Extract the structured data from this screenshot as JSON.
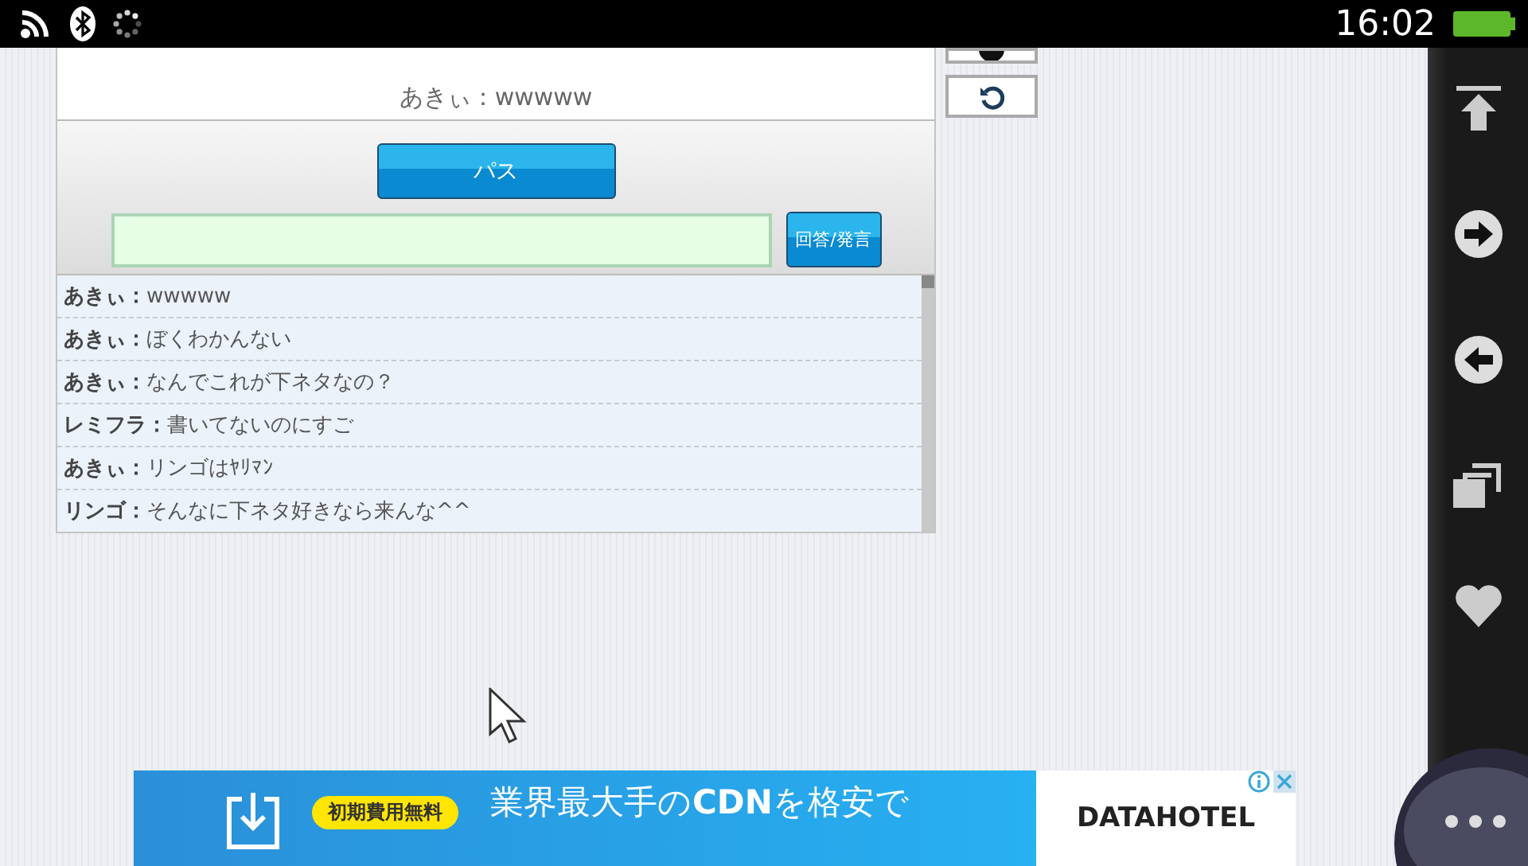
{
  "status_bar": {
    "time": "16:02"
  },
  "chat": {
    "last_message": "あきぃ：wwwww",
    "pass_button": "パス",
    "answer_button": "回答/発言",
    "messages": [
      {
        "name": "あきぃ：",
        "text": "wwwww"
      },
      {
        "name": "あきぃ：",
        "text": "ぼくわかんない"
      },
      {
        "name": "あきぃ：",
        "text": "なんでこれが下ネタなの？"
      },
      {
        "name": "レミフラ：",
        "text": "書いてないのにすご"
      },
      {
        "name": "あきぃ：",
        "text": "リンゴはﾔﾘﾏﾝ"
      },
      {
        "name": "リンゴ：",
        "text": "そんなに下ネタ好きなら来んな^^"
      }
    ]
  },
  "ad": {
    "badge": "初期費用無料",
    "headline": "業界最大手の**CDN**を格安で",
    "brand": "DATAHOTEL"
  }
}
